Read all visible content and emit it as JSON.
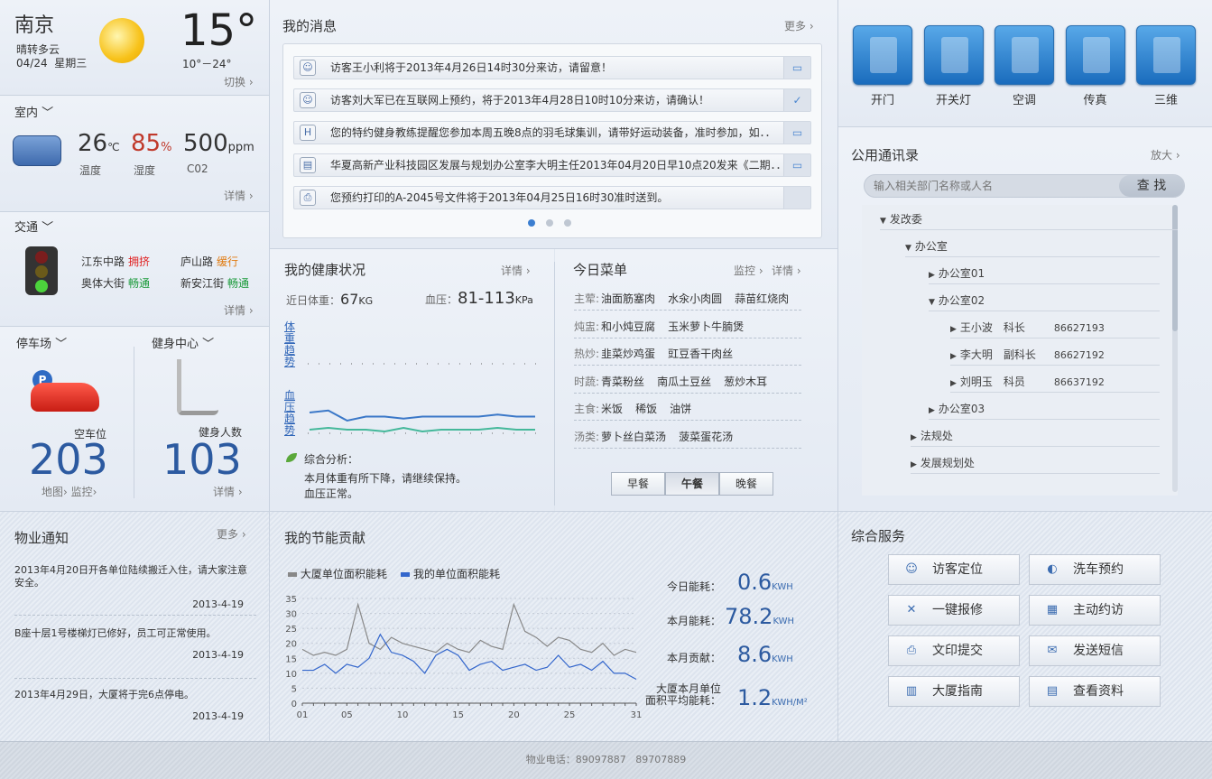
{
  "weather": {
    "city": "南京",
    "desc": "晴转多云",
    "date": "04/24",
    "weekday": "星期三",
    "temp": "15°",
    "range": "10°－24°",
    "switch": "切换"
  },
  "indoor": {
    "title": "室内",
    "temp_val": "26",
    "temp_unit": "℃",
    "temp_label": "温度",
    "humid_val": "85",
    "humid_unit": "%",
    "humid_label": "湿度",
    "co2_val": "500",
    "co2_unit": "ppm",
    "co2_label": "C02",
    "more": "详情"
  },
  "traffic": {
    "title": "交通",
    "roads": [
      {
        "name": "江东中路",
        "status": "拥挤",
        "color": "#e02020"
      },
      {
        "name": "庐山路",
        "status": "缓行",
        "color": "#e07a10"
      },
      {
        "name": "奥体大街",
        "status": "畅通",
        "color": "#1a9a3a"
      },
      {
        "name": "新安江街",
        "status": "畅通",
        "color": "#1a9a3a"
      }
    ],
    "more": "详情"
  },
  "parking": {
    "title": "停车场",
    "label": "空车位",
    "value": "203",
    "map": "地图",
    "monitor": "监控"
  },
  "gym": {
    "title": "健身中心",
    "label": "健身人数",
    "value": "103",
    "more": "详情"
  },
  "messages": {
    "title": "我的消息",
    "more": "更多",
    "items": [
      {
        "text": "访客王小利将于2013年4月26日14时30分来访，请留意！",
        "icon": "visitor-icon",
        "action": "chat-icon"
      },
      {
        "text": "访客刘大军已在互联网上预约，将于2013年4月28日10时10分来访，请确认！",
        "icon": "visitor-icon",
        "action": "confirm-icon"
      },
      {
        "text": "您的特约健身教练提醒您参加本周五晚8点的羽毛球集训，请带好运动装备，准时参加，如．．",
        "icon": "fitness-icon",
        "action": "chat-icon"
      },
      {
        "text": "华夏高新产业科技园区发展与规划办公室李大明主任2013年04月20日早10点20发来《二期．．",
        "icon": "document-icon",
        "action": "chat-icon"
      },
      {
        "text": "您预约打印的A-2045号文件将于2013年04月25日16时30准时送到。",
        "icon": "printer-icon",
        "action": ""
      }
    ]
  },
  "health": {
    "title": "我的健康状况",
    "more": "详情",
    "weight_label": "近日体重：",
    "weight_val": "67",
    "weight_unit": "KG",
    "bp_label": "血压：",
    "bp_val": "81-113",
    "bp_unit": "KPa",
    "weight_trend": "体重趋势",
    "bp_trend": "血压趋势",
    "analysis_title": "综合分析：",
    "analysis_1": "本月体重有所下降，请继续保持。",
    "analysis_2": "血压正常。",
    "weight_series": [
      62,
      60,
      62,
      62,
      61,
      61,
      62,
      61,
      61,
      62,
      61,
      60,
      56
    ],
    "bp_high": [
      42,
      43,
      38,
      40,
      40,
      39,
      40,
      40,
      40,
      40,
      41,
      40,
      40
    ],
    "bp_low": [
      40,
      41,
      40,
      40,
      39,
      41,
      39,
      40,
      40,
      40,
      41,
      40,
      40
    ]
  },
  "menu": {
    "title": "今日菜单",
    "monitor": "监控",
    "more": "详情",
    "rows": [
      {
        "cat": "主荤:",
        "items": [
          "油面筋塞肉",
          "水汆小肉圆",
          "蒜苗红烧肉"
        ]
      },
      {
        "cat": "炖盅:",
        "items": [
          "和小炖豆腐",
          "玉米萝卜牛腩煲"
        ]
      },
      {
        "cat": "热炒:",
        "items": [
          "韭菜炒鸡蛋",
          "豇豆香干肉丝"
        ]
      },
      {
        "cat": "时蔬:",
        "items": [
          "青菜粉丝",
          "南瓜土豆丝",
          "葱炒木耳"
        ]
      },
      {
        "cat": "主食:",
        "items": [
          "米饭",
          "稀饭",
          "油饼"
        ]
      },
      {
        "cat": "汤类:",
        "items": [
          "萝卜丝白菜汤",
          "菠菜蛋花汤"
        ]
      }
    ],
    "meals": [
      "早餐",
      "午餐",
      "晚餐"
    ]
  },
  "tools": [
    {
      "label": "开门",
      "icon": "door-icon"
    },
    {
      "label": "开关灯",
      "icon": "bulb-icon"
    },
    {
      "label": "空调",
      "icon": "aircon-icon"
    },
    {
      "label": "传真",
      "icon": "fax-icon"
    },
    {
      "label": "三维",
      "icon": "3d-building-icon"
    }
  ],
  "directory": {
    "title": "公用通讯录",
    "more": "放大",
    "placeholder": "输入相关部门名称或人名",
    "search": "查 找",
    "root": "发改委",
    "office": "办公室",
    "o1": "办公室01",
    "o2": "办公室02",
    "o3": "办公室03",
    "people": [
      {
        "name": "王小波",
        "title": "科长",
        "phone": "86627193"
      },
      {
        "name": "李大明",
        "title": "副科长",
        "phone": "86627192"
      },
      {
        "name": "刘明玉",
        "title": "科员",
        "phone": "86637192"
      }
    ],
    "law": "法规处",
    "plan": "发展规划处"
  },
  "notices": {
    "title": "物业通知",
    "more": "更多",
    "items": [
      {
        "text": "2013年4月20日开各单位陆续搬迁入住，请大家注意安全。",
        "date": "2013-4-19"
      },
      {
        "text": "B座十层1号楼梯灯已修好，员工可正常使用。",
        "date": "2013-4-19"
      },
      {
        "text": "2013年4月29日，大厦将于完6点停电。",
        "date": "2013-4-19"
      }
    ]
  },
  "energy": {
    "title": "我的节能贡献",
    "legend_a": "大厦单位面积能耗",
    "legend_b": "我的单位面积能耗",
    "today_l": "今日能耗：",
    "today_v": "0.6",
    "month_l": "本月能耗：",
    "month_v": "78.2",
    "contrib_l": "本月贡献：",
    "contrib_v": "8.6",
    "avg_l1": "大厦本月单位",
    "avg_l2": "面积平均能耗：",
    "avg_v": "1.2",
    "unit": "KWH",
    "unit2": "KWH/M²"
  },
  "chart_data": {
    "type": "line",
    "x": [
      1,
      2,
      3,
      4,
      5,
      6,
      7,
      8,
      9,
      10,
      11,
      12,
      13,
      14,
      15,
      16,
      17,
      18,
      19,
      20,
      21,
      22,
      23,
      24,
      25,
      26,
      27,
      28,
      29,
      30,
      31
    ],
    "xticks": [
      "01",
      "05",
      "10",
      "15",
      "20",
      "25",
      "31"
    ],
    "yticks": [
      0,
      5,
      10,
      15,
      20,
      25,
      30,
      35
    ],
    "ylim": [
      0,
      35
    ],
    "series": [
      {
        "name": "大厦单位面积能耗",
        "color": "#888888",
        "values": [
          18,
          16,
          17,
          16,
          18,
          33,
          20,
          18,
          22,
          20,
          19,
          18,
          17,
          20,
          18,
          17,
          21,
          19,
          18,
          33,
          24,
          22,
          19,
          22,
          21,
          18,
          17,
          20,
          16,
          18,
          17
        ]
      },
      {
        "name": "我的单位面积能耗",
        "color": "#3366cc",
        "values": [
          11,
          11,
          13,
          10,
          13,
          12,
          15,
          23,
          17,
          16,
          14,
          10,
          16,
          18,
          16,
          11,
          13,
          14,
          11,
          12,
          13,
          11,
          12,
          16,
          12,
          13,
          11,
          14,
          10,
          10,
          8
        ]
      }
    ]
  },
  "services": {
    "title": "综合服务",
    "items": [
      {
        "label": "访客定位",
        "icon": "visitor-icon"
      },
      {
        "label": "洗车预约",
        "icon": "car-icon"
      },
      {
        "label": "一键报修",
        "icon": "repair-icon"
      },
      {
        "label": "主动约访",
        "icon": "contact-icon"
      },
      {
        "label": "文印提交",
        "icon": "printer-icon"
      },
      {
        "label": "发送短信",
        "icon": "mail-icon"
      },
      {
        "label": "大厦指南",
        "icon": "guide-icon"
      },
      {
        "label": "查看资料",
        "icon": "folder-icon"
      }
    ]
  },
  "footer": {
    "phone_label": "物业电话：",
    "phone1": "89097887",
    "phone2": "89707889"
  }
}
